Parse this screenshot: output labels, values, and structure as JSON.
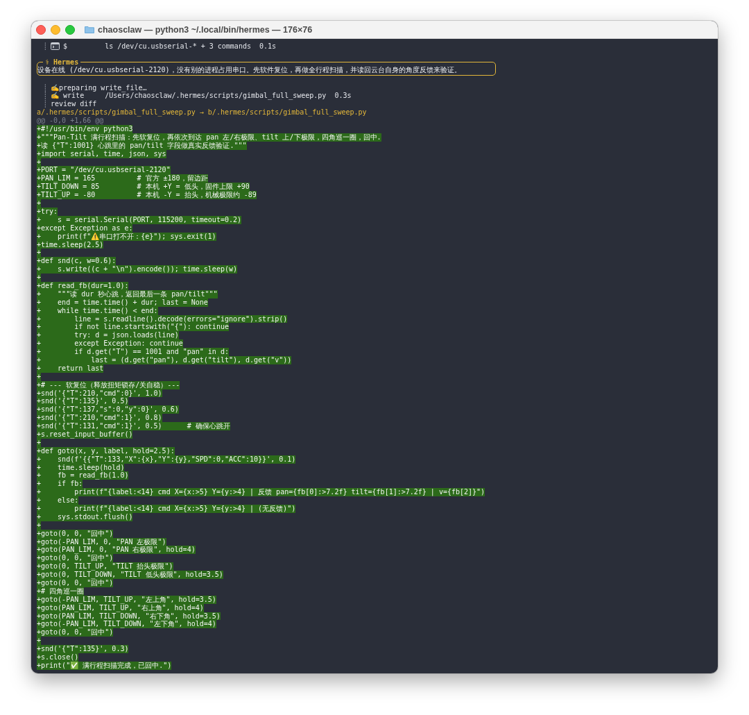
{
  "window": {
    "title": "chaosclaw — python3 ~/.local/bin/hermes — 176×76"
  },
  "tool_lines_top": [
    {
      "kind": "command",
      "bar": "┊",
      "text": "$         ls /dev/cu.usbserial-* + 3 commands  0.1s"
    }
  ],
  "hermes_box": {
    "title": "⚕ Hermes",
    "message": "设备在线 (/dev/cu.usbserial-2120)，没有别的进程占用串口。先软件复位，再做全行程扫描，并读回云台自身的角度反馈来验证。"
  },
  "tool_lines": [
    {
      "bar": "┊",
      "text": "✍️preparing write_file…"
    },
    {
      "bar": "┊",
      "text": "✍️ write     /Users/chaosclaw/.hermes/scripts/gimbal_full_sweep.py  0.3s"
    },
    {
      "bar": "┊",
      "text": "review diff"
    }
  ],
  "diff": {
    "file_header": "a/.hermes/scripts/gimbal_full_sweep.py → b/.hermes/scripts/gimbal_full_sweep.py",
    "hunk_header": "@@ -0,0 +1,66 @@",
    "added_lines": [
      "+#!/usr/bin/env python3",
      "+\"\"\"Pan-Tilt 满行程扫描：先软复位，再依次到达 pan 左/右极限、tilt 上/下极限，四角巡一圈，回中.",
      "+读 {\"T\":1001} 心跳里的 pan/tilt 字段做真实反馈验证.\"\"\"",
      "+import serial, time, json, sys",
      "+",
      "+PORT = \"/dev/cu.usbserial-2120\"",
      "+PAN_LIM = 165          # 官方 ±180，留边距",
      "+TILT_DOWN = 85         # 本机 +Y = 低头，固件上限 +90",
      "+TILT_UP = -80          # 本机 -Y = 抬头，机械极限约 -89",
      "+",
      "+try:",
      "+    s = serial.Serial(PORT, 115200, timeout=0.2)",
      "+except Exception as e:",
      "+    print(f\"⚠️串口打不开：{e}\"); sys.exit(1)",
      "+time.sleep(2.5)",
      "+",
      "+def snd(c, w=0.6):",
      "+    s.write((c + \"\\n\").encode()); time.sleep(w)",
      "+",
      "+def read_fb(dur=1.0):",
      "+    \"\"\"读 dur 秒心跳，返回最后一条 pan/tilt\"\"\"",
      "+    end = time.time() + dur; last = None",
      "+    while time.time() < end:",
      "+        line = s.readline().decode(errors=\"ignore\").strip()",
      "+        if not line.startswith(\"{\"): continue",
      "+        try: d = json.loads(line)",
      "+        except Exception: continue",
      "+        if d.get(\"T\") == 1001 and \"pan\" in d:",
      "+            last = (d.get(\"pan\"), d.get(\"tilt\"), d.get(\"v\"))",
      "+    return last",
      "+",
      "+# --- 软复位（释放扭矩锁存/关自稳）---",
      "+snd('{\"T\":210,\"cmd\":0}', 1.0)",
      "+snd('{\"T\":135}', 0.5)",
      "+snd('{\"T\":137,\"s\":0,\"y\":0}', 0.6)",
      "+snd('{\"T\":210,\"cmd\":1}', 0.8)",
      "+snd('{\"T\":131,\"cmd\":1}', 0.5)      # 确保心跳开",
      "+s.reset_input_buffer()",
      "+",
      "+def goto(x, y, label, hold=2.5):",
      "+    snd(f'{{\"T\":133,\"X\":{x},\"Y\":{y},\"SPD\":0,\"ACC\":10}}', 0.1)",
      "+    time.sleep(hold)",
      "+    fb = read_fb(1.0)",
      "+    if fb:",
      "+        print(f\"{label:<14} cmd X={x:>5} Y={y:>4} | 反馈 pan={fb[0]:>7.2f} tilt={fb[1]:>7.2f} | v={fb[2]}\")",
      "+    else:",
      "+        print(f\"{label:<14} cmd X={x:>5} Y={y:>4} | (无反馈)\")",
      "+    sys.stdout.flush()",
      "+",
      "+goto(0, 0, \"回中\")",
      "+goto(-PAN_LIM, 0, \"PAN 左极限\")",
      "+goto(PAN_LIM, 0, \"PAN 右极限\", hold=4)",
      "+goto(0, 0, \"回中\")",
      "+goto(0, TILT_UP, \"TILT 抬头极限\")",
      "+goto(0, TILT_DOWN, \"TILT 低头极限\", hold=3.5)",
      "+goto(0, 0, \"回中\")",
      "+# 四角巡一圈",
      "+goto(-PAN_LIM, TILT_UP, \"左上角\", hold=3.5)",
      "+goto(PAN_LIM, TILT_UP, \"右上角\", hold=4)",
      "+goto(PAN_LIM, TILT_DOWN, \"右下角\", hold=3.5)",
      "+goto(-PAN_LIM, TILT_DOWN, \"左下角\", hold=4)",
      "+goto(0, 0, \"回中\")",
      "+",
      "+snd('{\"T\":135}', 0.3)",
      "+s.close()",
      "+print(\"✅ 满行程扫描完成，已回中.\")"
    ]
  }
}
